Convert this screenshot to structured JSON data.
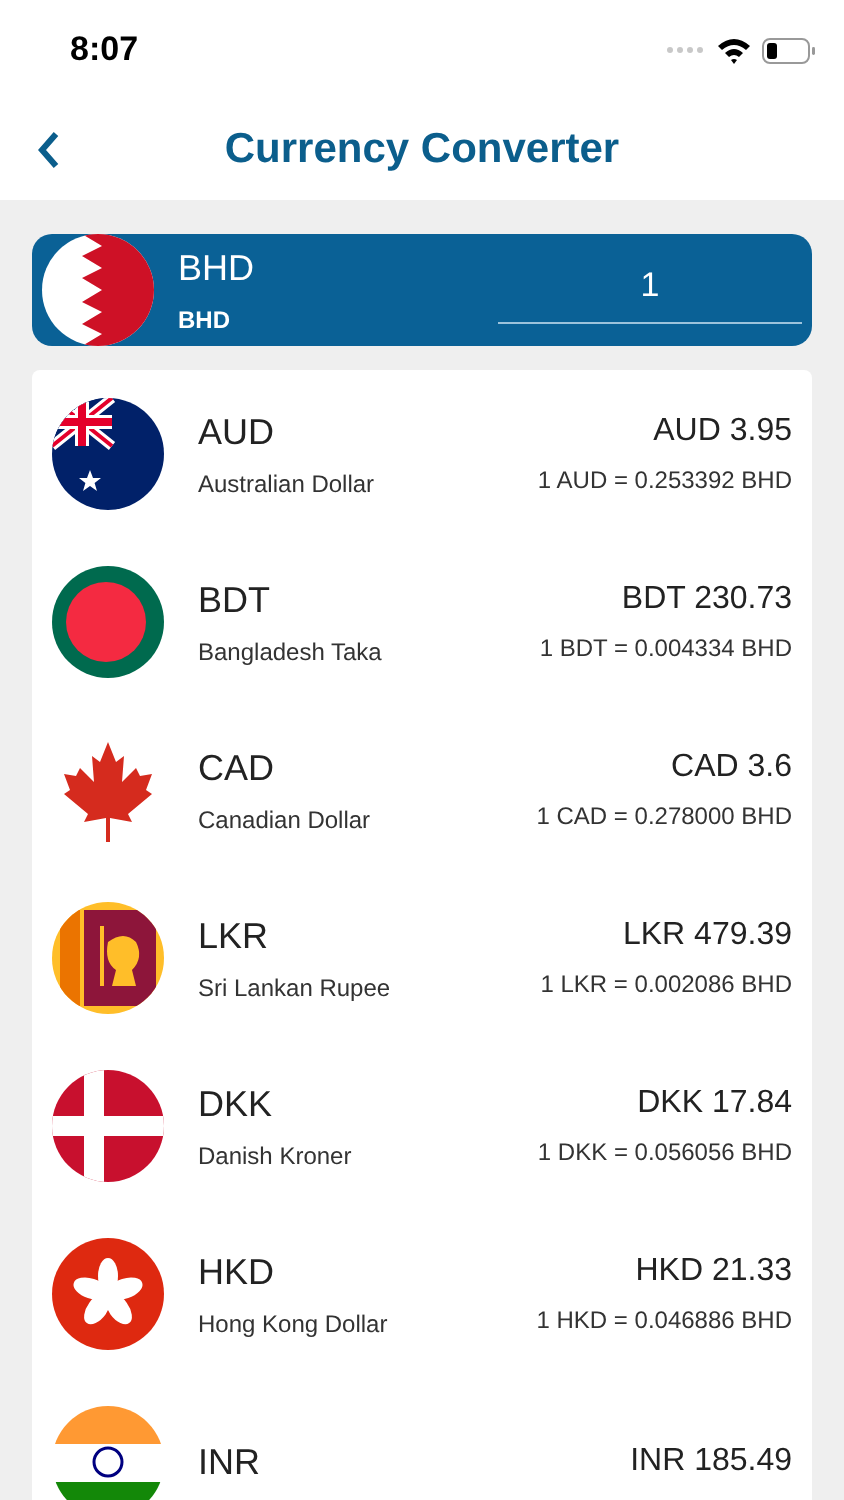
{
  "status_bar": {
    "time": "8:07"
  },
  "nav": {
    "title": "Currency Converter"
  },
  "base": {
    "kind": "bh",
    "code": "BHD",
    "name": "BHD",
    "amount": "1"
  },
  "rates": [
    {
      "kind": "au",
      "code": "AUD",
      "name": "Australian Dollar",
      "amount": "AUD 3.95",
      "rate": "1 AUD = 0.253392 BHD"
    },
    {
      "kind": "bd",
      "code": "BDT",
      "name": "Bangladesh Taka",
      "amount": "BDT 230.73",
      "rate": "1 BDT = 0.004334 BHD"
    },
    {
      "kind": "ca",
      "code": "CAD",
      "name": "Canadian Dollar",
      "amount": "CAD 3.6",
      "rate": "1 CAD = 0.278000 BHD"
    },
    {
      "kind": "lk",
      "code": "LKR",
      "name": "Sri Lankan Rupee",
      "amount": "LKR 479.39",
      "rate": "1 LKR = 0.002086 BHD"
    },
    {
      "kind": "dk",
      "code": "DKK",
      "name": "Danish Kroner",
      "amount": "DKK 17.84",
      "rate": "1 DKK = 0.056056 BHD"
    },
    {
      "kind": "hk",
      "code": "HKD",
      "name": "Hong Kong Dollar",
      "amount": "HKD 21.33",
      "rate": "1 HKD = 0.046886 BHD"
    },
    {
      "kind": "in",
      "code": "INR",
      "amount": "INR 185.49"
    }
  ]
}
